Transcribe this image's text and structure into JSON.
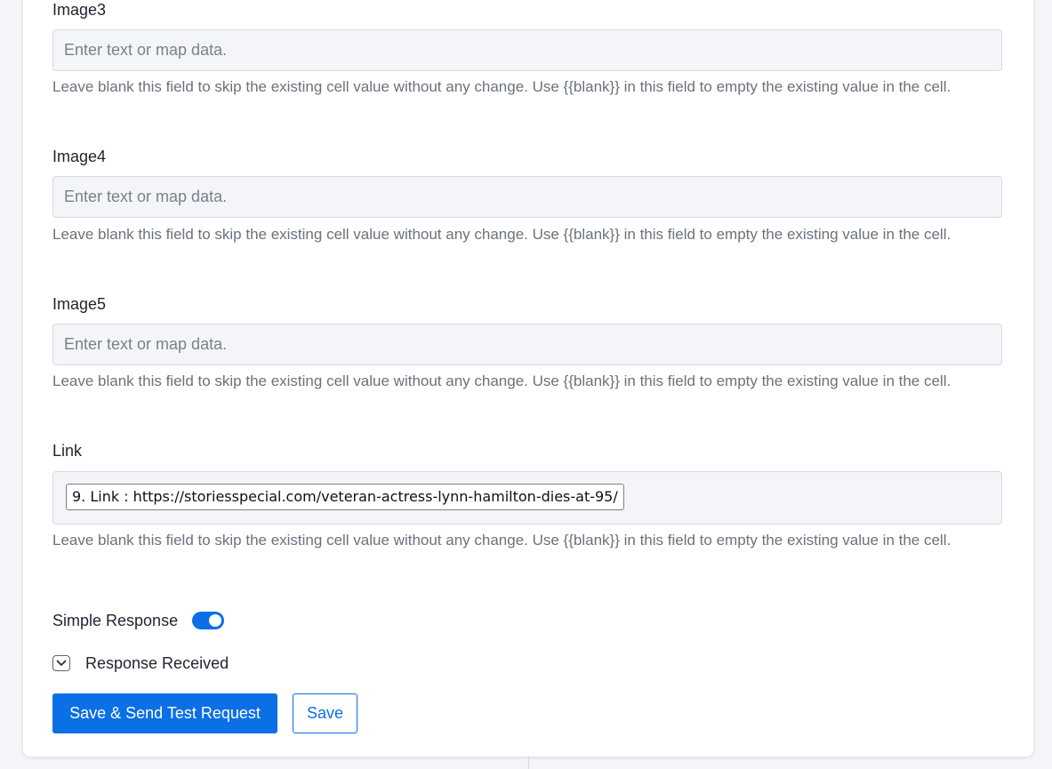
{
  "fields": [
    {
      "label": "Image3",
      "placeholder": "Enter text or map data.",
      "help": "Leave blank this field to skip the existing cell value without any change. Use {{blank}} in this field to empty the existing value in the cell."
    },
    {
      "label": "Image4",
      "placeholder": "Enter text or map data.",
      "help": "Leave blank this field to skip the existing cell value without any change. Use {{blank}} in this field to empty the existing value in the cell."
    },
    {
      "label": "Image5",
      "placeholder": "Enter text or map data.",
      "help": "Leave blank this field to skip the existing cell value without any change. Use {{blank}} in this field to empty the existing value in the cell."
    }
  ],
  "link_field": {
    "label": "Link",
    "mapped_value": "9. Link : https://storiesspecial.com/veteran-actress-lynn-hamilton-dies-at-95/",
    "help": "Leave blank this field to skip the existing cell value without any change. Use {{blank}} in this field to empty the existing value in the cell."
  },
  "simple_response": {
    "label": "Simple Response",
    "enabled": true
  },
  "response_received": {
    "label": "Response Received",
    "icon": "chevron-down-icon"
  },
  "buttons": {
    "save_send": "Save & Send Test Request",
    "save": "Save"
  },
  "colors": {
    "accent": "#0b6fe6",
    "input_bg": "#f3f5f8",
    "help_text": "#6b727c"
  }
}
